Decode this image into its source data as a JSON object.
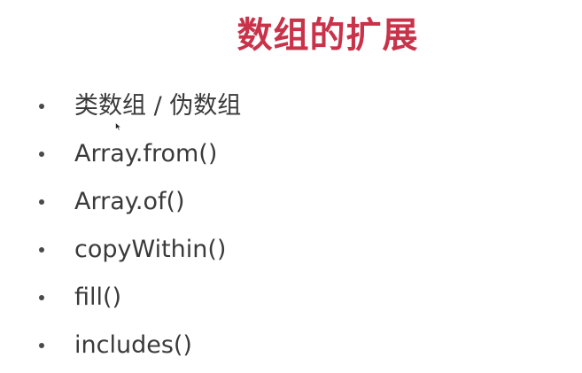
{
  "slide": {
    "title": "数组的扩展",
    "items": [
      {
        "label": "类数组 / 伪数组"
      },
      {
        "label": "Array.from()"
      },
      {
        "label": "Array.of()"
      },
      {
        "label": "copyWithin()"
      },
      {
        "label": "fill()"
      },
      {
        "label": "includes()"
      }
    ]
  },
  "colors": {
    "title": "#c8334a",
    "text": "#3a3a3a",
    "bullet": "#4a4a4a",
    "background": "#ffffff"
  },
  "icons": {
    "cursor": "mouse-pointer-icon",
    "bullet": "bullet-dot-icon"
  }
}
